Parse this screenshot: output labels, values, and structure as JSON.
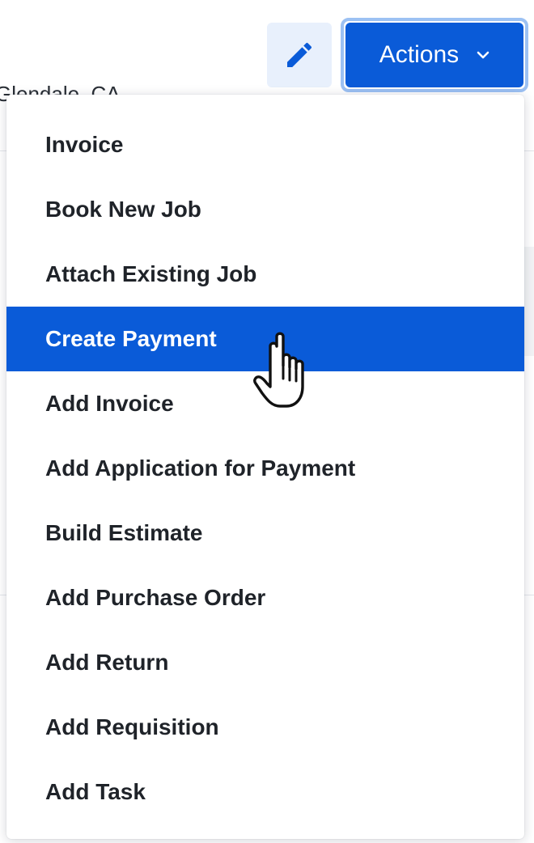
{
  "header": {
    "location": "Glendale, CA",
    "edit_icon": "pencil-icon",
    "actions_label": "Actions",
    "actions_icon": "chevron-down-icon"
  },
  "menu": {
    "items": [
      {
        "label": "Invoice",
        "state": "default"
      },
      {
        "label": "Book New Job",
        "state": "default"
      },
      {
        "label": "Attach Existing Job",
        "state": "default"
      },
      {
        "label": "Create Payment",
        "state": "highlighted"
      },
      {
        "label": "Add Invoice",
        "state": "default"
      },
      {
        "label": "Add Application for Payment",
        "state": "default"
      },
      {
        "label": "Build Estimate",
        "state": "default"
      },
      {
        "label": "Add Purchase Order",
        "state": "default"
      },
      {
        "label": "Add Return",
        "state": "default"
      },
      {
        "label": "Add Requisition",
        "state": "default"
      },
      {
        "label": "Add Task",
        "state": "default"
      }
    ]
  },
  "cursor": {
    "icon": "hand-pointer-icon"
  },
  "colors": {
    "accent": "#0a5bd8",
    "focus_ring": "#9cc1f3",
    "edit_button_bg": "#e8f0fc",
    "text": "#1f2329"
  }
}
